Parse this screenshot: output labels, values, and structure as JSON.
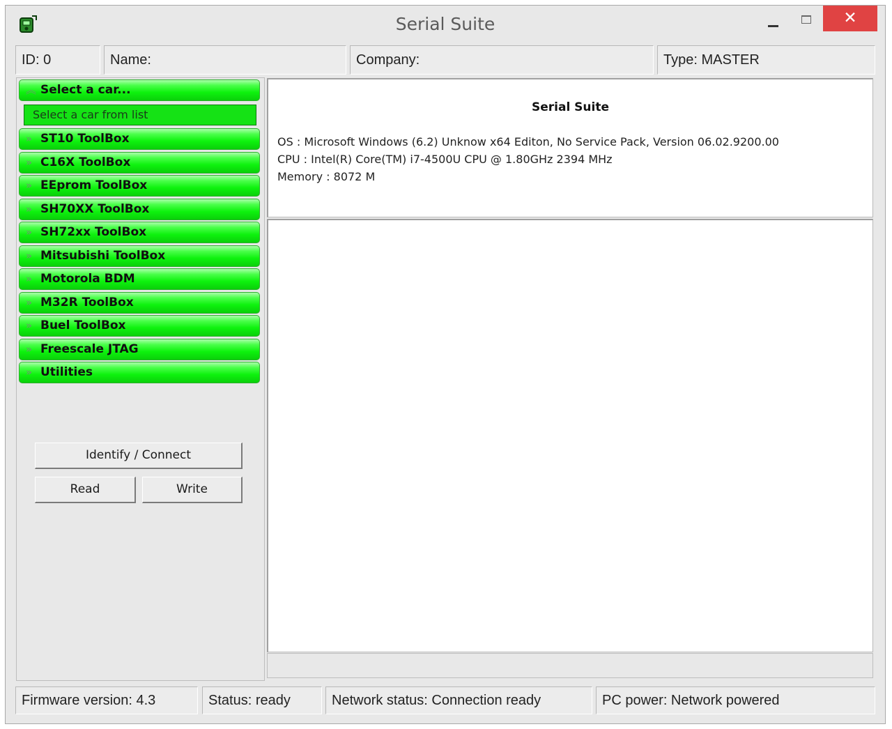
{
  "window": {
    "title": "Serial Suite",
    "close_glyph": "✕"
  },
  "infobar": {
    "id": "ID: 0",
    "name": "Name:",
    "company": "Company:",
    "type": "Type: MASTER"
  },
  "sidebar": {
    "header": "Select a car...",
    "car_select_value": "Select a car from list",
    "items": [
      "ST10 ToolBox",
      "C16X ToolBox",
      "EEprom ToolBox",
      "SH70XX ToolBox",
      "SH72xx ToolBox",
      "Mitsubishi ToolBox",
      "Motorola BDM",
      "M32R ToolBox",
      "Buel ToolBox",
      "Freescale JTAG",
      "Utilities"
    ],
    "identify_label": "Identify / Connect",
    "read_label": "Read",
    "write_label": "Write"
  },
  "info": {
    "title": "Serial Suite",
    "os": "OS : Microsoft Windows (6.2) Unknow x64 Editon, No Service Pack, Version 06.02.9200.00",
    "cpu": "CPU : Intel(R) Core(TM) i7-4500U CPU @ 1.80GHz 2394 MHz",
    "memory": "Memory : 8072 M"
  },
  "statusbar": {
    "firmware": "Firmware version: 4.3",
    "status": "Status: ready",
    "network": "Network status: Connection ready",
    "power": "PC power: Network powered"
  },
  "colors": {
    "accent_green": "#0ef20e",
    "close_red": "#e04343"
  }
}
